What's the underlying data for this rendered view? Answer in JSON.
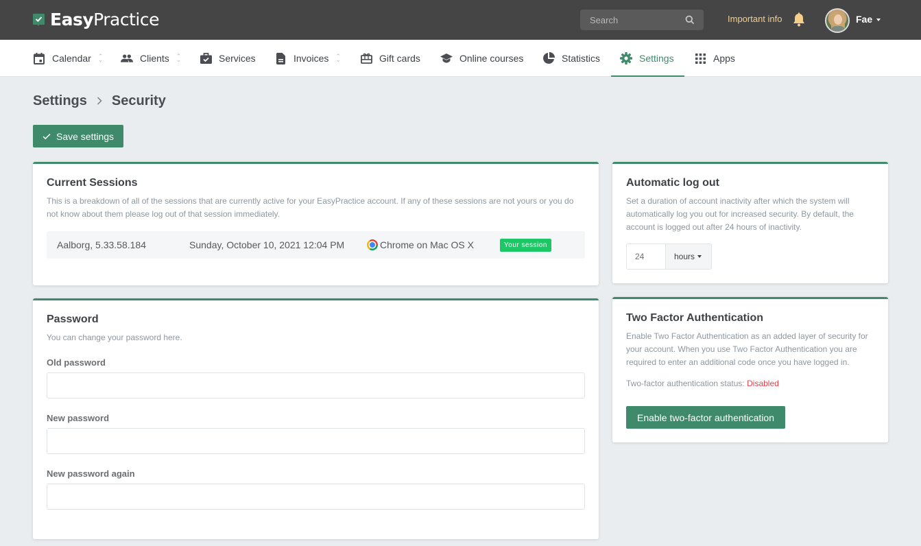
{
  "app": {
    "logo_bold": "Easy",
    "logo_light": "Practice"
  },
  "topbar": {
    "search_placeholder": "Search",
    "important_info": "Important info",
    "user_name": "Fae"
  },
  "nav": {
    "items": [
      {
        "label": "Calendar",
        "icon": "calendar-icon",
        "has_sort": true
      },
      {
        "label": "Clients",
        "icon": "users-icon",
        "has_sort": true
      },
      {
        "label": "Services",
        "icon": "briefcase-check-icon",
        "has_sort": false
      },
      {
        "label": "Invoices",
        "icon": "document-icon",
        "has_sort": true
      },
      {
        "label": "Gift cards",
        "icon": "gift-card-icon",
        "has_sort": false
      },
      {
        "label": "Online courses",
        "icon": "graduation-cap-icon",
        "has_sort": false
      },
      {
        "label": "Statistics",
        "icon": "pie-chart-icon",
        "has_sort": false
      },
      {
        "label": "Settings",
        "icon": "gear-icon",
        "has_sort": false,
        "active": true
      },
      {
        "label": "Apps",
        "icon": "grid-icon",
        "has_sort": false
      }
    ]
  },
  "breadcrumb": {
    "parent": "Settings",
    "separator": "›",
    "current": "Security"
  },
  "toolbar": {
    "save_label": "Save settings"
  },
  "sessions": {
    "title": "Current Sessions",
    "description": "This is a breakdown of all of the sessions that are currently active for your EasyPractice account. If any of these sessions are not yours or you do not know about them please log out of that session immediately.",
    "rows": [
      {
        "location": "Aalborg, 5.33.58.184",
        "datetime": "Sunday, October 10, 2021 12:04 PM",
        "browser": "Chrome on Mac OS X",
        "badge": "Your session"
      }
    ]
  },
  "password": {
    "title": "Password",
    "description": "You can change your password here.",
    "fields": [
      {
        "label": "Old password",
        "value": ""
      },
      {
        "label": "New password",
        "value": ""
      },
      {
        "label": "New password again",
        "value": ""
      }
    ]
  },
  "autologout": {
    "title": "Automatic log out",
    "description": "Set a duration of account inactivity after which the system will automatically log you out for increased security. By default, the account is logged out after 24 hours of inactivity.",
    "value": "24",
    "unit": "hours"
  },
  "twofa": {
    "title": "Two Factor Authentication",
    "description": "Enable Two Factor Authentication as an added layer of security for your account. When you use Two Factor Authentication you are required to enter an additional code once you have logged in.",
    "status_label": "Two-factor authentication status:",
    "status_value": "Disabled",
    "button_label": "Enable two-factor authentication"
  },
  "colors": {
    "brand": "#3f8a6b",
    "topbar": "#454545",
    "important": "#f5cf8a",
    "badge": "#1cc866",
    "danger": "#e8404a"
  }
}
